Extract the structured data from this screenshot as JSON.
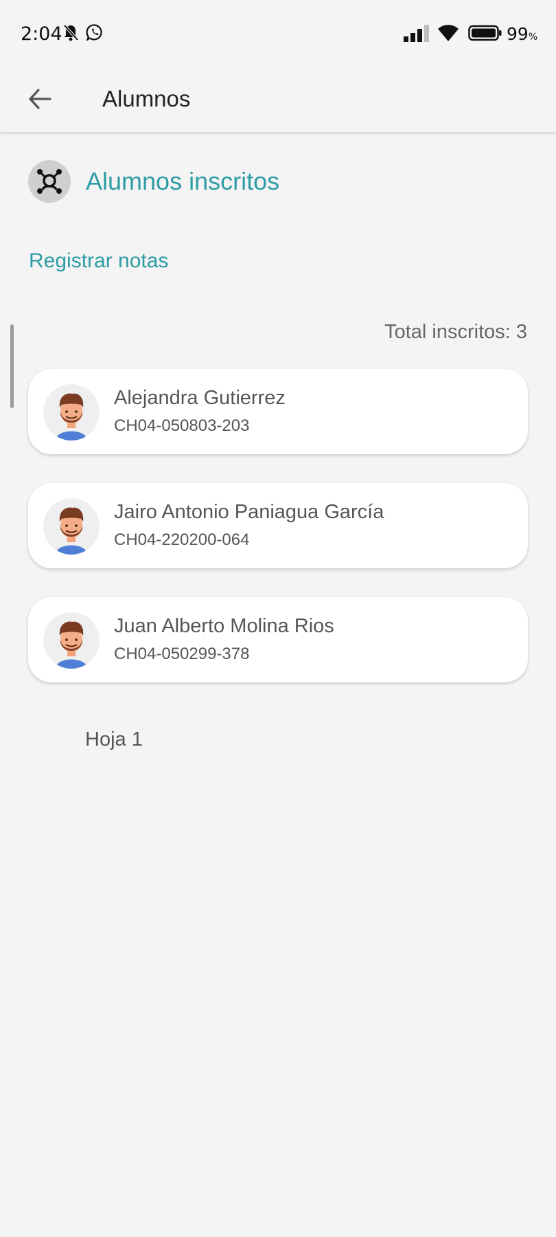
{
  "status_bar": {
    "time": "2:04",
    "battery_percent": "99",
    "battery_unit": "%",
    "icons": [
      "bell-off-icon",
      "whatsapp-icon",
      "signal-icon",
      "wifi-icon",
      "battery-icon"
    ]
  },
  "app_bar": {
    "title": "Alumnos",
    "back_icon": "arrow-left-icon"
  },
  "section": {
    "title": "Alumnos inscritos",
    "icon": "student-group-icon",
    "accent_color": "#2e9ca4"
  },
  "actions": {
    "register_grades": "Registrar notas"
  },
  "summary": {
    "total_label": "Total inscritos: 3"
  },
  "students": [
    {
      "name": "Alejandra Gutierrez",
      "id": "CH04-050803-203",
      "avatar": "bearded-man-avatar"
    },
    {
      "name": "Jairo Antonio Paniagua García",
      "id": "CH04-220200-064",
      "avatar": "bearded-man-avatar"
    },
    {
      "name": "Juan Alberto Molina Rios",
      "id": "CH04-050299-378",
      "avatar": "bearded-man-avatar"
    }
  ],
  "pagination": {
    "label": "Hoja 1"
  }
}
